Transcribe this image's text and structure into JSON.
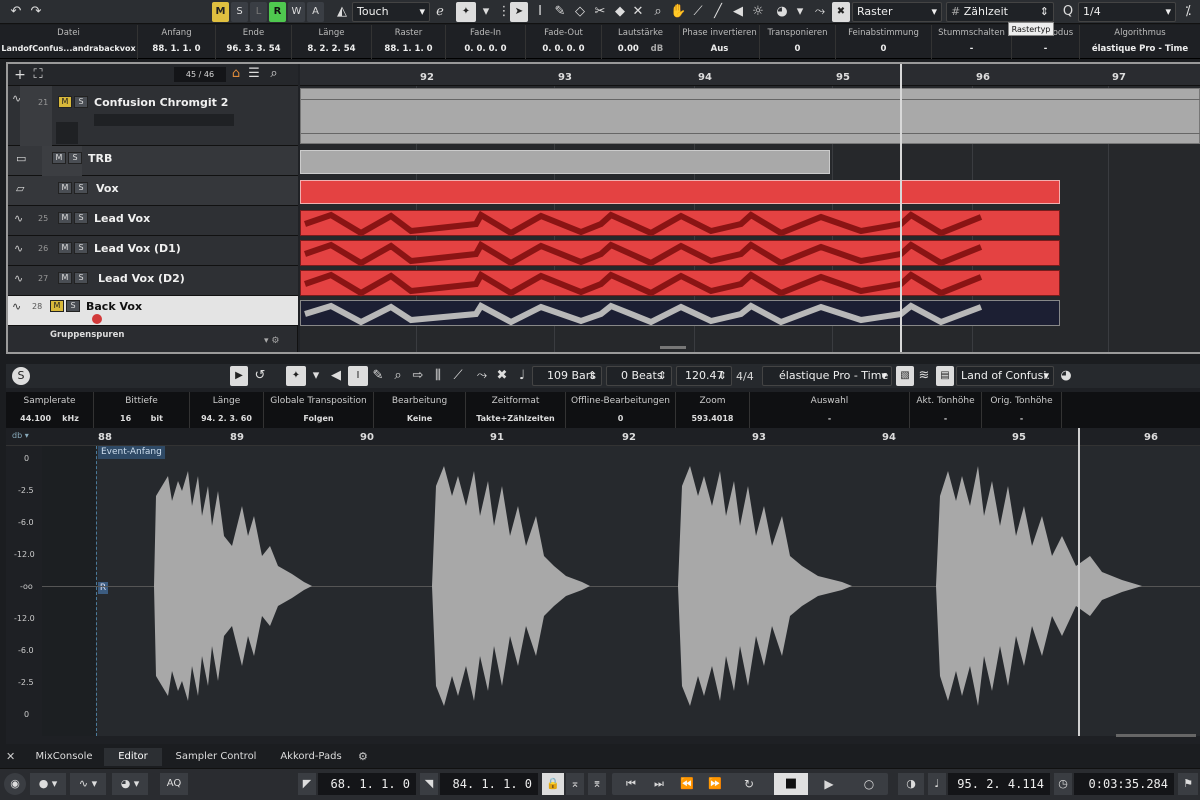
{
  "toolbar": {
    "mode_buttons": [
      "M",
      "S",
      "L",
      "R",
      "W",
      "A"
    ],
    "automation_mode": "Touch",
    "grid_label": "Raster",
    "grid_type": "Zählzeit",
    "grid_tooltip": "Rastertyp",
    "quantize": "1/4"
  },
  "info_line": [
    {
      "label": "Datei",
      "value": "LandofConfus...andrabackvox"
    },
    {
      "label": "Anfang",
      "value": "88. 1. 1.   0"
    },
    {
      "label": "Ende",
      "value": "96. 3. 3. 54"
    },
    {
      "label": "Länge",
      "value": "8. 2. 2. 54"
    },
    {
      "label": "Raster",
      "value": "88. 1. 1.   0"
    },
    {
      "label": "Fade-In",
      "value": "0. 0. 0.   0"
    },
    {
      "label": "Fade-Out",
      "value": "0. 0. 0.   0"
    },
    {
      "label": "Lautstärke",
      "value": "0.00",
      "unit": "dB"
    },
    {
      "label": "Phase invertieren",
      "value": "Aus"
    },
    {
      "label": "Transponieren",
      "value": "0"
    },
    {
      "label": "Feinabstimmung",
      "value": "0"
    },
    {
      "label": "Stummschalten",
      "value": "-"
    },
    {
      "label": "Musik-Modus",
      "value": "-"
    },
    {
      "label": "Algorithmus",
      "value": "élastique Pro - Time"
    }
  ],
  "project": {
    "track_counter": "45 / 46",
    "ruler_bars": [
      "92",
      "93",
      "94",
      "95",
      "96",
      "97"
    ],
    "tracks": [
      {
        "num": "21",
        "name": "Confusion Chromgit 2"
      },
      {
        "num": "",
        "name": "TRB"
      },
      {
        "num": "",
        "name": "Vox"
      },
      {
        "num": "25",
        "name": "Lead Vox"
      },
      {
        "num": "26",
        "name": "Lead Vox (D1)"
      },
      {
        "num": "27",
        "name": "Lead Vox (D2)"
      },
      {
        "num": "28",
        "name": "Back Vox"
      }
    ],
    "group_tracks_label": "Gruppenspuren"
  },
  "editor": {
    "toolbar": {
      "bars": "109 Bars",
      "beats": "0 Beats",
      "tempo": "120.47",
      "signature": "4/4",
      "algorithm": "élastique Pro - Time",
      "clip_name": "Land of Confusi."
    },
    "info": [
      {
        "label": "Samplerate",
        "value": "44.100",
        "unit": "kHz"
      },
      {
        "label": "Bittiefe",
        "value": "16",
        "unit": "bit"
      },
      {
        "label": "Länge",
        "value": "94. 2. 3. 60"
      },
      {
        "label": "Globale Transposition",
        "value": "Folgen"
      },
      {
        "label": "Bearbeitung",
        "value": "Keine"
      },
      {
        "label": "Zeitformat",
        "value": "Takte+Zählzeiten"
      },
      {
        "label": "Offline-Bearbeitungen",
        "value": "0"
      },
      {
        "label": "Zoom",
        "value": "593.4018"
      },
      {
        "label": "Auswahl",
        "value": "-"
      },
      {
        "label": "Akt. Tonhöhe",
        "value": "-"
      },
      {
        "label": "Orig. Tonhöhe",
        "value": "-"
      }
    ],
    "ruler_bars": [
      "88",
      "89",
      "90",
      "91",
      "92",
      "93",
      "94",
      "95",
      "96"
    ],
    "db_label": "db",
    "db_scale": [
      "0",
      "-2.5",
      "-6.0",
      "-12.0",
      "-oo",
      "-12.0",
      "-6.0",
      "-2.5",
      "0"
    ],
    "event_start": "Event-Anfang",
    "marker_r": "R"
  },
  "tabs": [
    "MixConsole",
    "Editor",
    "Sampler Control",
    "Akkord-Pads"
  ],
  "transport": {
    "left_locator": "68. 1. 1.   0",
    "right_locator": "84. 1. 1.   0",
    "position_bars": "95. 2. 4.114",
    "position_time": "0:03:35.284",
    "aq": "AQ"
  }
}
